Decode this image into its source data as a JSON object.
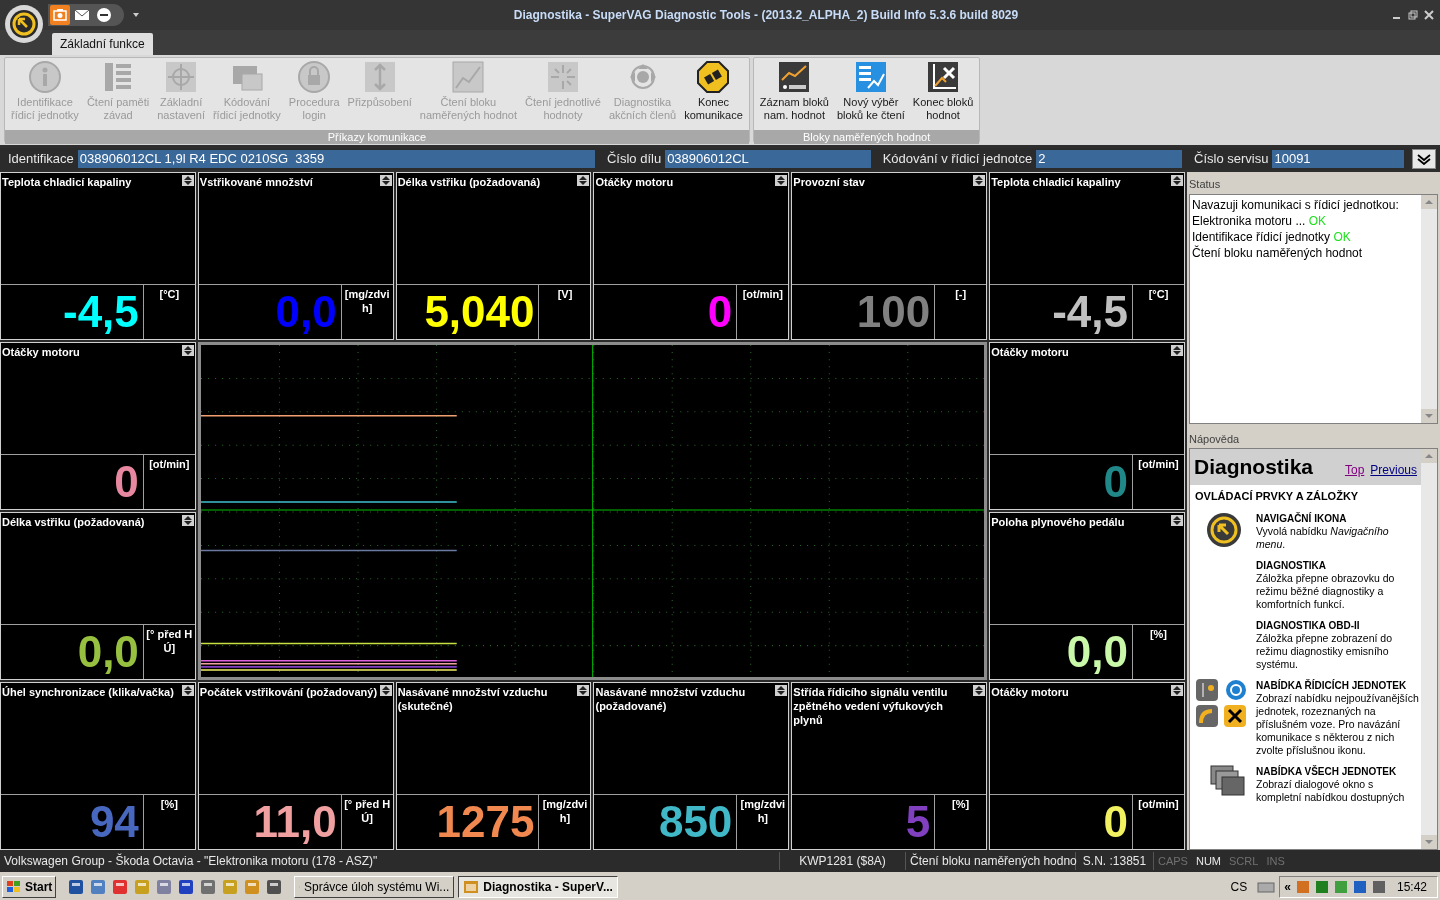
{
  "window": {
    "title": "Diagnostika - SuperVAG Diagnostic Tools -  (2013.2_ALPHA_2) Build Info 5.3.6 build 8029"
  },
  "tabs": [
    {
      "label": "Základní funkce",
      "selected": true
    }
  ],
  "ribbon_groups": [
    {
      "label": "Příkazy komunikace",
      "buttons": [
        {
          "label": "Identifikace\nřídicí jednotky",
          "kind": "info",
          "disabled": true
        },
        {
          "label": "Čtení paměti\nzávad",
          "kind": "list",
          "disabled": true
        },
        {
          "label": "Základní\nnastavení",
          "kind": "crosshair",
          "disabled": true
        },
        {
          "label": "Kódování\nřídicí jednotky",
          "kind": "coding",
          "disabled": true
        },
        {
          "label": "Procedura\nlogin",
          "kind": "lock",
          "disabled": true
        },
        {
          "label": "Přizpůsobení",
          "kind": "adapt",
          "disabled": true
        },
        {
          "label": "Čtení bloku\nnaměřených hodnot",
          "kind": "chart",
          "disabled": true
        },
        {
          "label": "Čtení jednotlivé\nhodnoty",
          "kind": "sparkle",
          "disabled": true
        },
        {
          "label": "Diagnostika\nakčních členů",
          "kind": "actuator",
          "disabled": true
        },
        {
          "label": "Konec\nkomunikace",
          "kind": "stop",
          "disabled": false
        }
      ]
    },
    {
      "label": "Bloky naměřených hodnot",
      "buttons": [
        {
          "label": "Záznam bloků\nnam. hodnot",
          "kind": "rec",
          "disabled": false
        },
        {
          "label": "Nový výběr\nbloků ke čtení",
          "kind": "select",
          "disabled": false
        },
        {
          "label": "Konec bloků\nhodnot",
          "kind": "chartx",
          "disabled": false
        }
      ]
    }
  ],
  "id_bar": [
    {
      "label": "Identifikace",
      "value": "038906012CL 1,9l R4 EDC 0210SG  3359"
    },
    {
      "label": "Číslo dílu",
      "value": "038906012CL"
    },
    {
      "label": "Kódování v řídicí jednotce",
      "value": "2"
    },
    {
      "label": "Číslo servisu",
      "value": "10091"
    }
  ],
  "gauges": [
    {
      "title": "Teplota chladicí kapaliny",
      "value": "-4,5",
      "unit": "[°C]",
      "color": "#00ffff"
    },
    {
      "title": "Vstřikované množství",
      "value": "0,0",
      "unit": "[mg/zdvih]",
      "color": "#0000ff"
    },
    {
      "title": "Délka vstřiku (požadovaná)",
      "value": "5,040",
      "unit": "[V]",
      "color": "#ffff00"
    },
    {
      "title": "Otáčky motoru",
      "value": "0",
      "unit": "[ot/min]",
      "color": "#ff00ff"
    },
    {
      "title": "Provozní stav",
      "value": "100",
      "unit": "[-]",
      "color": "#808080"
    },
    {
      "title": "Teplota chladicí kapaliny",
      "value": "-4,5",
      "unit": "[°C]",
      "color": "#c0c0c0"
    },
    {
      "title": "Otáčky motoru",
      "value": "0",
      "unit": "[ot/min]",
      "color": "#e888a0"
    },
    {
      "title": "Otáčky motoru",
      "value": "0",
      "unit": "[ot/min]",
      "color": "#208888"
    },
    {
      "title": "Délka vstřiku (požadovaná)",
      "value": "0,0",
      "unit": "[° před HÚ]",
      "color": "#98c040"
    },
    {
      "title": "Poloha plynového pedálu",
      "value": "0,0",
      "unit": "[%]",
      "color": "#c8f8a8"
    },
    {
      "title": "Úhel synchronizace (klika/vačka)",
      "value": "94",
      "unit": "[%]",
      "color": "#4868c0"
    },
    {
      "title": "Počátek vstřikování (požadovaný)",
      "value": "11,0",
      "unit": "[° před HÚ]",
      "color": "#f0a0a0"
    },
    {
      "title": "Nasávané množství vzduchu (skutečné)",
      "value": "1275",
      "unit": "[mg/zdvih]",
      "color": "#f08850"
    },
    {
      "title": "Nasávané množství vzduchu (požadované)",
      "value": "850",
      "unit": "[mg/zdvih]",
      "color": "#40b8c8"
    },
    {
      "title": "Střída řídicího signálu ventilu zpětného vedení výfukových plynů",
      "value": "5",
      "unit": "[%]",
      "color": "#8040c0"
    },
    {
      "title": "Otáčky motoru",
      "value": "0",
      "unit": "[ot/min]",
      "color": "#f0f060"
    }
  ],
  "status_panel": {
    "title": "Status",
    "lines": [
      {
        "text": "Navazuji komunikaci s řídicí jednotkou:"
      },
      {
        "text": "Elektronika motoru ...",
        "result": "OK"
      },
      {
        "text": "Identifikace řídicí jednotky",
        "result": "OK"
      },
      {
        "text": "Čtení bloku naměřených hodnot"
      }
    ]
  },
  "help_panel": {
    "title": "Nápověda",
    "heading": "Diagnostika",
    "links": [
      "Top",
      "Previous"
    ],
    "subheading": "OVLÁDACÍ PRVKY A ZÁLOŽKY",
    "items": [
      {
        "kind": "navigation",
        "title": "NAVIGAČNÍ IKONA",
        "text": "Vyvolá nabídku *Navigačního menu*."
      },
      {
        "kind": "text",
        "title": "DIAGNOSTIKA",
        "text": "Záložka přepne obrazovku do režimu běžné diagnostiky a komfortních funkcí."
      },
      {
        "kind": "text",
        "title": "DIAGNOSTIKA OBD-II",
        "text": "Záložka přepne zobrazení do režimu diagnostiky emisního systému."
      },
      {
        "kind": "units",
        "title": "NABÍDKA ŘÍDICÍCH JEDNOTEK",
        "text": "Zobrazí nabídku nejpoužívanějších jednotek, rozeznaných na příslušném voze. Pro navázání komunikace s některou z nich zvolte příslušnou ikonu."
      },
      {
        "kind": "all_units",
        "title": "NABÍDKA VŠECH JEDNOTEK",
        "text": "Zobrazí dialogové okno s kompletní nabídkou dostupných"
      }
    ]
  },
  "status_bar": {
    "fields": [
      "Volkswagen Group - Škoda Octavia - \"Elektronika motoru (178 - ASZ)\"",
      "KWP1281 ($8A)",
      "Čtení bloku naměřených hodno",
      "S.N. :13851"
    ],
    "indicators": [
      {
        "label": "CAPS",
        "on": false
      },
      {
        "label": "NUM",
        "on": true
      },
      {
        "label": "SCRL",
        "on": false
      },
      {
        "label": "INS",
        "on": false
      }
    ]
  },
  "taskbar": {
    "start": "Start",
    "tasks": [
      {
        "label": "Správce úloh systému Wi...",
        "selected": false
      },
      {
        "label": "Diagnostika - SuperV...",
        "selected": true
      }
    ],
    "language": "CS",
    "tray_expand": "«",
    "clock": "15:42"
  }
}
